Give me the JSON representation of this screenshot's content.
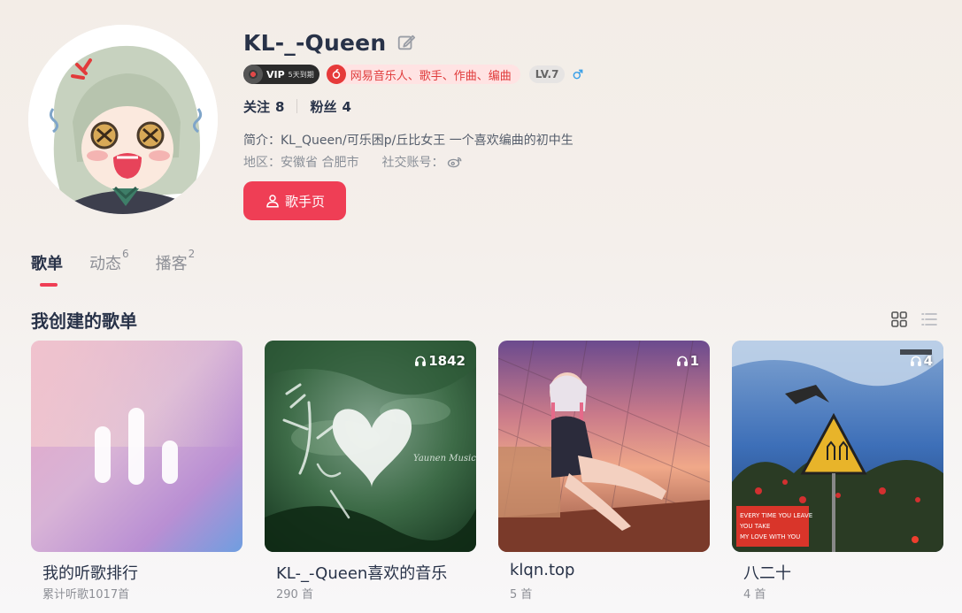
{
  "profile": {
    "name": "KL-_-Queen",
    "vip": {
      "label": "VIP",
      "sub": "5天到期"
    },
    "musician": "网易音乐人、歌手、作曲、编曲",
    "level": "LV.7",
    "following_label": "关注",
    "following_count": "8",
    "followers_label": "粉丝",
    "followers_count": "4",
    "intro": "简介：KL_Queen/可乐困p/丘比女王 一个喜欢编曲的初中生",
    "region": "地区：安徽省 合肥市",
    "social": "社交账号：",
    "singer_button": "歌手页"
  },
  "tabs": [
    {
      "label": "歌单",
      "badge": ""
    },
    {
      "label": "动态",
      "badge": "6"
    },
    {
      "label": "播客",
      "badge": "2"
    }
  ],
  "section_title": "我创建的歌单",
  "playlists": [
    {
      "title": "我的听歌排行",
      "sub": "累计听歌1017首",
      "plays": ""
    },
    {
      "title": "KL-_-Queen喜欢的音乐",
      "sub": "290 首",
      "plays": "1842"
    },
    {
      "title": "klqn.top",
      "sub": "5 首",
      "plays": "1"
    },
    {
      "title": "八二十",
      "sub": "4 首",
      "plays": "4"
    }
  ],
  "colors": {
    "accent": "#ef3e55",
    "title_text": "#283248",
    "muted_text": "#8d8f96"
  },
  "icons": {
    "edit": "pencil-square-icon",
    "gender": "male-icon",
    "weibo": "weibo-icon",
    "singer": "person-icon",
    "play_count": "headphones-icon",
    "grid_view": "grid-view-icon",
    "list_view": "list-view-icon"
  }
}
